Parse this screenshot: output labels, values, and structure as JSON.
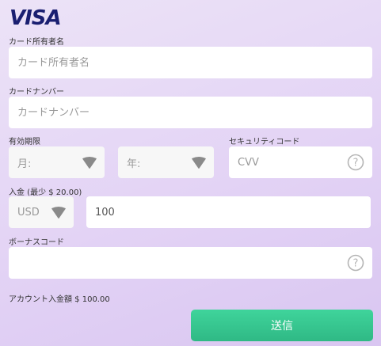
{
  "logo": "VISA",
  "cardholder": {
    "label": "カード所有者名",
    "placeholder": "カード所有者名"
  },
  "card_number": {
    "label": "カードナンバー",
    "placeholder": "カードナンバー"
  },
  "expiry": {
    "label": "有効期限",
    "month": "月:",
    "year": "年:"
  },
  "security": {
    "label": "セキュリティコード",
    "placeholder": "CVV"
  },
  "amount": {
    "label": "入金 (最少 $ 20.00)",
    "currency": "USD",
    "value": "100"
  },
  "bonus": {
    "label": "ボーナスコード",
    "placeholder": ""
  },
  "account": {
    "text": "アカウント入金額 $ 100.00"
  },
  "submit_label": "送信",
  "colors": {
    "brand": "#1a1f71",
    "submit": "#35c48f"
  }
}
